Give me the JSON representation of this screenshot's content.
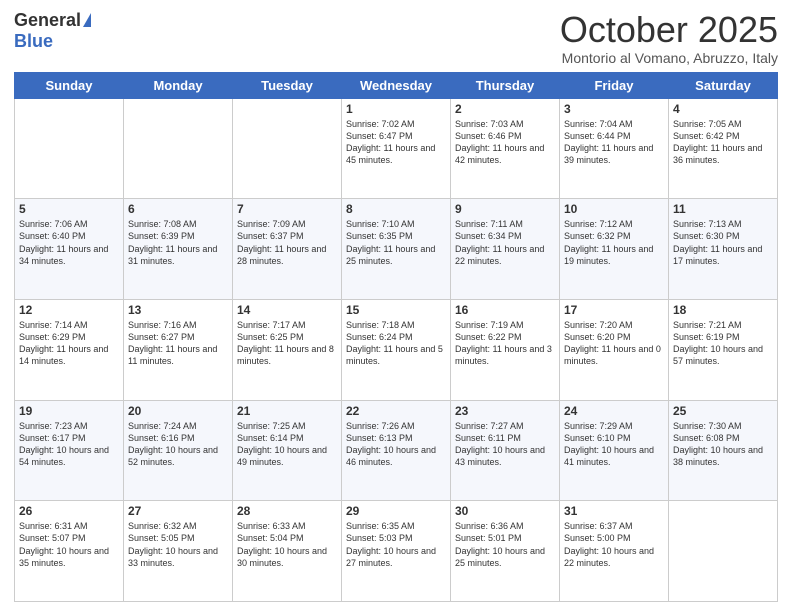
{
  "header": {
    "logo_general": "General",
    "logo_blue": "Blue",
    "month_title": "October 2025",
    "location": "Montorio al Vomano, Abruzzo, Italy"
  },
  "days_of_week": [
    "Sunday",
    "Monday",
    "Tuesday",
    "Wednesday",
    "Thursday",
    "Friday",
    "Saturday"
  ],
  "weeks": [
    [
      {
        "day": "",
        "text": ""
      },
      {
        "day": "",
        "text": ""
      },
      {
        "day": "",
        "text": ""
      },
      {
        "day": "1",
        "text": "Sunrise: 7:02 AM\nSunset: 6:47 PM\nDaylight: 11 hours and 45 minutes."
      },
      {
        "day": "2",
        "text": "Sunrise: 7:03 AM\nSunset: 6:46 PM\nDaylight: 11 hours and 42 minutes."
      },
      {
        "day": "3",
        "text": "Sunrise: 7:04 AM\nSunset: 6:44 PM\nDaylight: 11 hours and 39 minutes."
      },
      {
        "day": "4",
        "text": "Sunrise: 7:05 AM\nSunset: 6:42 PM\nDaylight: 11 hours and 36 minutes."
      }
    ],
    [
      {
        "day": "5",
        "text": "Sunrise: 7:06 AM\nSunset: 6:40 PM\nDaylight: 11 hours and 34 minutes."
      },
      {
        "day": "6",
        "text": "Sunrise: 7:08 AM\nSunset: 6:39 PM\nDaylight: 11 hours and 31 minutes."
      },
      {
        "day": "7",
        "text": "Sunrise: 7:09 AM\nSunset: 6:37 PM\nDaylight: 11 hours and 28 minutes."
      },
      {
        "day": "8",
        "text": "Sunrise: 7:10 AM\nSunset: 6:35 PM\nDaylight: 11 hours and 25 minutes."
      },
      {
        "day": "9",
        "text": "Sunrise: 7:11 AM\nSunset: 6:34 PM\nDaylight: 11 hours and 22 minutes."
      },
      {
        "day": "10",
        "text": "Sunrise: 7:12 AM\nSunset: 6:32 PM\nDaylight: 11 hours and 19 minutes."
      },
      {
        "day": "11",
        "text": "Sunrise: 7:13 AM\nSunset: 6:30 PM\nDaylight: 11 hours and 17 minutes."
      }
    ],
    [
      {
        "day": "12",
        "text": "Sunrise: 7:14 AM\nSunset: 6:29 PM\nDaylight: 11 hours and 14 minutes."
      },
      {
        "day": "13",
        "text": "Sunrise: 7:16 AM\nSunset: 6:27 PM\nDaylight: 11 hours and 11 minutes."
      },
      {
        "day": "14",
        "text": "Sunrise: 7:17 AM\nSunset: 6:25 PM\nDaylight: 11 hours and 8 minutes."
      },
      {
        "day": "15",
        "text": "Sunrise: 7:18 AM\nSunset: 6:24 PM\nDaylight: 11 hours and 5 minutes."
      },
      {
        "day": "16",
        "text": "Sunrise: 7:19 AM\nSunset: 6:22 PM\nDaylight: 11 hours and 3 minutes."
      },
      {
        "day": "17",
        "text": "Sunrise: 7:20 AM\nSunset: 6:20 PM\nDaylight: 11 hours and 0 minutes."
      },
      {
        "day": "18",
        "text": "Sunrise: 7:21 AM\nSunset: 6:19 PM\nDaylight: 10 hours and 57 minutes."
      }
    ],
    [
      {
        "day": "19",
        "text": "Sunrise: 7:23 AM\nSunset: 6:17 PM\nDaylight: 10 hours and 54 minutes."
      },
      {
        "day": "20",
        "text": "Sunrise: 7:24 AM\nSunset: 6:16 PM\nDaylight: 10 hours and 52 minutes."
      },
      {
        "day": "21",
        "text": "Sunrise: 7:25 AM\nSunset: 6:14 PM\nDaylight: 10 hours and 49 minutes."
      },
      {
        "day": "22",
        "text": "Sunrise: 7:26 AM\nSunset: 6:13 PM\nDaylight: 10 hours and 46 minutes."
      },
      {
        "day": "23",
        "text": "Sunrise: 7:27 AM\nSunset: 6:11 PM\nDaylight: 10 hours and 43 minutes."
      },
      {
        "day": "24",
        "text": "Sunrise: 7:29 AM\nSunset: 6:10 PM\nDaylight: 10 hours and 41 minutes."
      },
      {
        "day": "25",
        "text": "Sunrise: 7:30 AM\nSunset: 6:08 PM\nDaylight: 10 hours and 38 minutes."
      }
    ],
    [
      {
        "day": "26",
        "text": "Sunrise: 6:31 AM\nSunset: 5:07 PM\nDaylight: 10 hours and 35 minutes."
      },
      {
        "day": "27",
        "text": "Sunrise: 6:32 AM\nSunset: 5:05 PM\nDaylight: 10 hours and 33 minutes."
      },
      {
        "day": "28",
        "text": "Sunrise: 6:33 AM\nSunset: 5:04 PM\nDaylight: 10 hours and 30 minutes."
      },
      {
        "day": "29",
        "text": "Sunrise: 6:35 AM\nSunset: 5:03 PM\nDaylight: 10 hours and 27 minutes."
      },
      {
        "day": "30",
        "text": "Sunrise: 6:36 AM\nSunset: 5:01 PM\nDaylight: 10 hours and 25 minutes."
      },
      {
        "day": "31",
        "text": "Sunrise: 6:37 AM\nSunset: 5:00 PM\nDaylight: 10 hours and 22 minutes."
      },
      {
        "day": "",
        "text": ""
      }
    ]
  ]
}
